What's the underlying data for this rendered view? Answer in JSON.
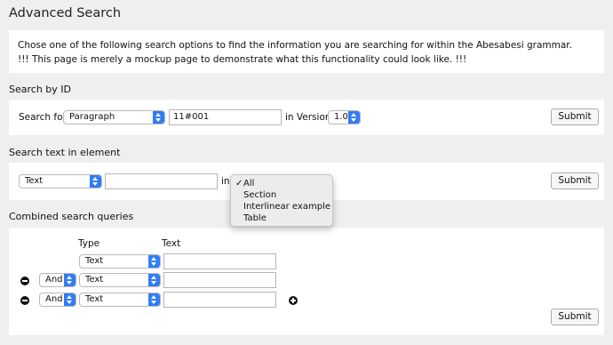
{
  "page_title": "Advanced Search",
  "intro": {
    "line1": "Chose one of the following search options to find the information you are searching for within the Abesabesi grammar.",
    "line2": "!!! This page is merely a mockup page to demonstrate what this functionality could look like. !!!"
  },
  "search_by_id": {
    "heading": "Search by ID",
    "search_for_label": "Search for",
    "type_select": "Paragraph",
    "id_value": "11#001",
    "in_version_label": "in Version",
    "version_select": "1.0",
    "submit": "Submit"
  },
  "search_text": {
    "heading": "Search text in element",
    "element_select": "Text",
    "text_value": "",
    "in_label": "in",
    "dropdown_options": [
      "All",
      "Section",
      "Interlinear example",
      "Table"
    ],
    "dropdown_selected": "All",
    "check_mark": "✓",
    "submit": "Submit"
  },
  "combined": {
    "heading": "Combined search queries",
    "col_type": "Type",
    "col_text": "Text",
    "rows": [
      {
        "operator": "",
        "type": "Text",
        "text": ""
      },
      {
        "operator": "And",
        "type": "Text",
        "text": ""
      },
      {
        "operator": "And",
        "type": "Text",
        "text": ""
      }
    ],
    "submit": "Submit"
  },
  "colors": {
    "select_arrow": "#2f7cf6",
    "panel": "#ffffff",
    "background": "#efefef"
  }
}
